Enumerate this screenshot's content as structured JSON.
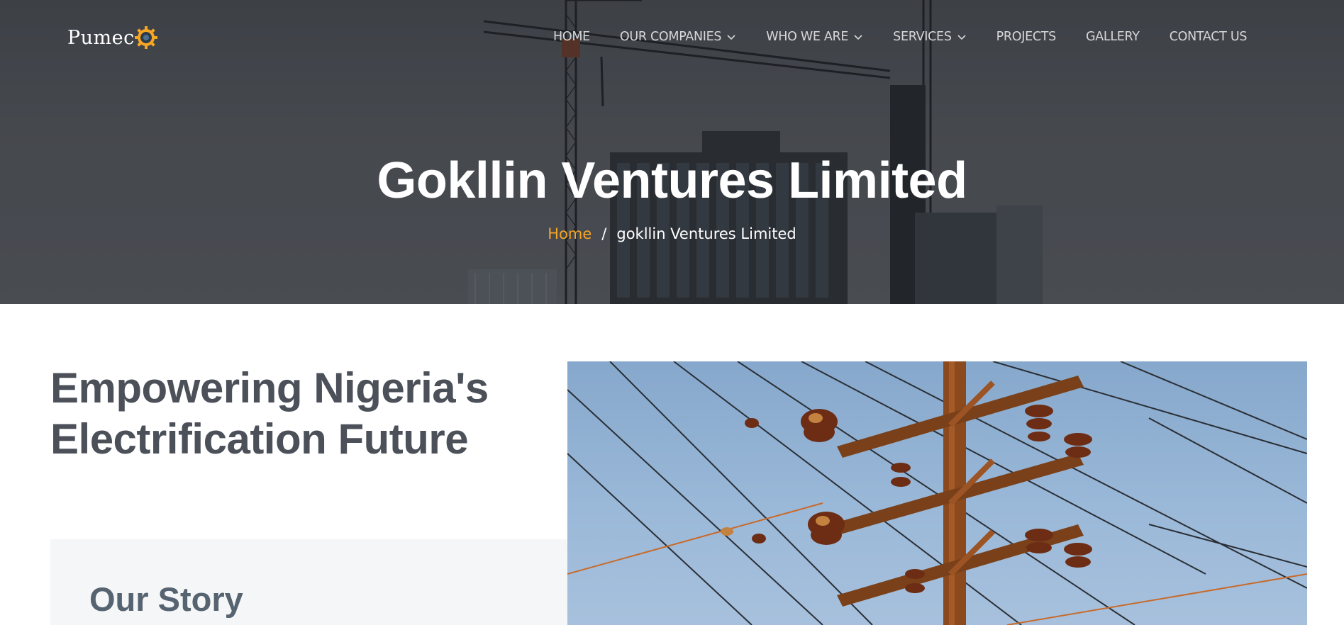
{
  "brand": {
    "logo_text": "Pumec",
    "accent": "#f5a623"
  },
  "nav": {
    "items": [
      {
        "label": "HOME",
        "dropdown": false
      },
      {
        "label": "OUR COMPANIES",
        "dropdown": true
      },
      {
        "label": "WHO WE ARE",
        "dropdown": true
      },
      {
        "label": "SERVICES",
        "dropdown": true
      },
      {
        "label": "PROJECTS",
        "dropdown": false
      },
      {
        "label": "GALLERY",
        "dropdown": false
      },
      {
        "label": "CONTACT US",
        "dropdown": false
      }
    ]
  },
  "hero": {
    "title": "Gokllin Ventures Limited",
    "breadcrumb": {
      "home": "Home",
      "separator": "/",
      "current": "gokllin Ventures Limited"
    }
  },
  "main": {
    "headline_line1": "Empowering Nigeria's",
    "headline_line2": "Electrification Future",
    "story_title": "Our Story"
  },
  "icons": {
    "dropdown": "chevron-down-icon",
    "logo": "gear-icon"
  }
}
